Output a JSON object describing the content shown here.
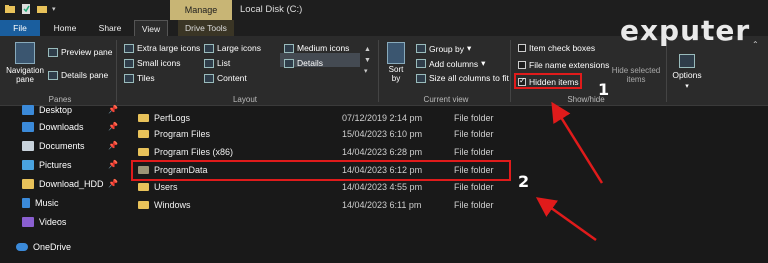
{
  "window": {
    "title": "Local Disk (C:)",
    "context_tab": "Manage"
  },
  "tabs": [
    "File",
    "Home",
    "Share",
    "View",
    "Drive Tools"
  ],
  "ribbon": {
    "panes": {
      "navigation_pane": "Navigation pane",
      "preview_pane": "Preview pane",
      "details_pane": "Details pane",
      "label": "Panes"
    },
    "layout": {
      "extra_large_icons": "Extra large icons",
      "large_icons": "Large icons",
      "medium_icons": "Medium icons",
      "small_icons": "Small icons",
      "list": "List",
      "details": "Details",
      "tiles": "Tiles",
      "content": "Content",
      "label": "Layout",
      "selected": "Details"
    },
    "current_view": {
      "sort_by": "Sort by",
      "group_by": "Group by",
      "add_columns": "Add columns",
      "size_all_columns": "Size all columns to fit",
      "label": "Current view"
    },
    "show_hide": {
      "item_check_boxes": "Item check boxes",
      "file_name_extensions": "File name extensions",
      "hidden_items": "Hidden items",
      "hide_selected_items": "Hide selected items",
      "label": "Show/hide",
      "item_check_boxes_checked": false,
      "file_name_extensions_checked": false,
      "hidden_items_checked": true
    },
    "options": "Options"
  },
  "nav": {
    "items": [
      {
        "label": "Desktop",
        "pinned": true,
        "icon": "desktop-icon",
        "color": "#3b8ad9"
      },
      {
        "label": "Downloads",
        "pinned": true,
        "icon": "download-icon",
        "color": "#3b8ad9"
      },
      {
        "label": "Documents",
        "pinned": true,
        "icon": "documents-icon",
        "color": "#c9d3dc"
      },
      {
        "label": "Pictures",
        "pinned": true,
        "icon": "pictures-icon",
        "color": "#4aa3df"
      },
      {
        "label": "Download_HDD",
        "pinned": true,
        "icon": "folder-icon",
        "color": "#e8c25a"
      },
      {
        "label": "Music",
        "pinned": false,
        "icon": "music-icon",
        "color": "#3b8ad9"
      },
      {
        "label": "Videos",
        "pinned": false,
        "icon": "videos-icon",
        "color": "#8a5fd0"
      },
      {
        "label": "OneDrive",
        "pinned": false,
        "icon": "cloud-icon",
        "color": "#3b8ad9"
      }
    ]
  },
  "files": [
    {
      "name": "PerfLogs",
      "date": "07/12/2019 2:14 pm",
      "type": "File folder",
      "hidden": false
    },
    {
      "name": "Program Files",
      "date": "15/04/2023 6:10 pm",
      "type": "File folder",
      "hidden": false
    },
    {
      "name": "Program Files (x86)",
      "date": "14/04/2023 6:28 pm",
      "type": "File folder",
      "hidden": false
    },
    {
      "name": "ProgramData",
      "date": "14/04/2023 6:12 pm",
      "type": "File folder",
      "hidden": true
    },
    {
      "name": "Users",
      "date": "14/04/2023 4:55 pm",
      "type": "File folder",
      "hidden": false
    },
    {
      "name": "Windows",
      "date": "14/04/2023 6:11 pm",
      "type": "File folder",
      "hidden": false
    }
  ],
  "annotations": {
    "step1": "1",
    "step2": "2"
  },
  "watermark": "exputer",
  "colors": {
    "highlight": "#e01b1b",
    "file_tab": "#1a5e9e",
    "manage_tab": "#c8b575"
  }
}
